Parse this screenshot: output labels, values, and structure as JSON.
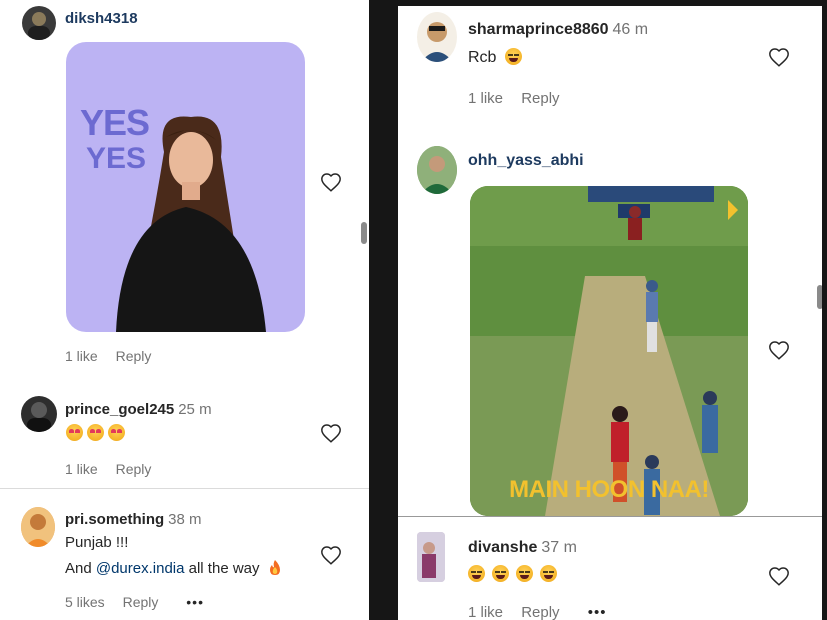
{
  "left": {
    "c1": {
      "username": "diksh4318",
      "gif_text_1": "YES",
      "gif_text_2": "YES",
      "likes": "1 like",
      "reply": "Reply"
    },
    "c2": {
      "username": "prince_goel245",
      "time": "25 m",
      "likes": "1 like",
      "reply": "Reply",
      "emoji_count": 3
    },
    "c3": {
      "username": "pri.something",
      "time": "38 m",
      "line1": "Punjab !!!",
      "line2_pre": "And ",
      "mention": "@durex.india",
      "line2_post": " all the way",
      "likes": "5 likes",
      "reply": "Reply",
      "more": "•••"
    }
  },
  "right": {
    "c1": {
      "username": "sharmaprince8860",
      "time": "46 m",
      "text": "Rcb",
      "likes": "1 like",
      "reply": "Reply"
    },
    "c2": {
      "username": "ohh_yass_abhi",
      "gif_caption": "MAIN HOON NAA!"
    },
    "c3": {
      "username": "divanshe",
      "time": "37 m",
      "likes": "1 like",
      "reply": "Reply",
      "more": "•••"
    }
  },
  "colors": {
    "accent_link": "#00376b",
    "gif_bg": "#bcb3f3",
    "pitch_green": "#5c8a3c",
    "caption_yellow": "#f2c12e"
  }
}
